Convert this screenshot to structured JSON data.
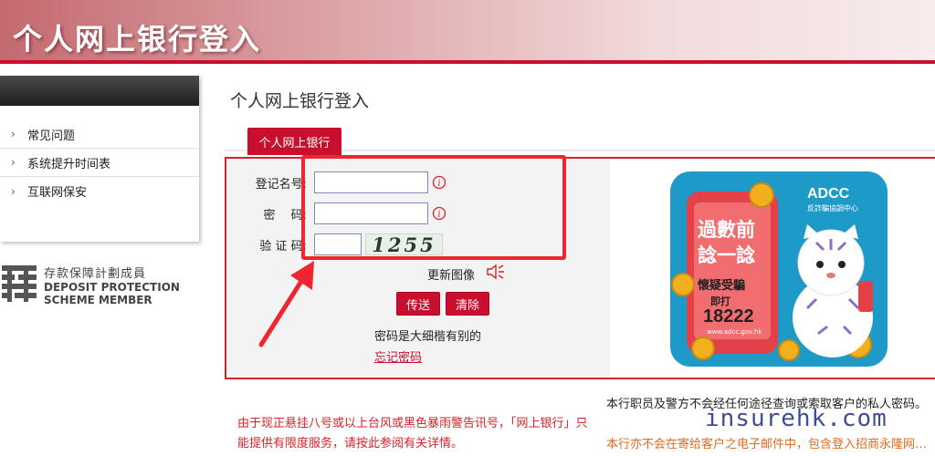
{
  "banner": {
    "title": "个人网上银行登入"
  },
  "sidebar": {
    "items": [
      {
        "label": "常见问题"
      },
      {
        "label": "系统提升时间表"
      },
      {
        "label": "互联网保安"
      }
    ]
  },
  "dps": {
    "cn": "存款保障計劃成員",
    "en_line1": "DEPOSIT PROTECTION",
    "en_line2": "SCHEME MEMBER"
  },
  "main": {
    "title": "个人网上银行登入",
    "tab_label": "个人网上银行"
  },
  "form": {
    "username_label": "登记名号:",
    "password_label": "密　 码:",
    "captcha_label": "验 证 码:",
    "username_value": "",
    "password_value": "",
    "captcha_value": "",
    "captcha_text": "1255",
    "refresh_label": "更新图像",
    "submit_label": "传送",
    "clear_label": "清除",
    "case_note": "密码是大细楷有别的",
    "forgot_label": "忘记密码"
  },
  "ad": {
    "org": "ADCC",
    "org_sub": "反詐騙協調中心",
    "line1": "過數前",
    "line2": "諗一諗",
    "line3": "懷疑受騙",
    "line4": "即打",
    "hotline": "18222",
    "site": "www.adcc.gov.hk",
    "colors": {
      "bg": "#1e9ac9",
      "phone": "#e2414a"
    }
  },
  "notices": {
    "typhoon": "由于现正悬挂八号或以上台风或黑色暴雨警告讯号，「网上银行」只能提供有限度服务，请按此参阅有关详情。",
    "staff": "本行职员及警方不会经任何途径查询或索取客户的私人密码。",
    "email": "本行亦不会在寄给客户之电子邮件中，包含登入招商永隆网…"
  },
  "watermark": "insurehk.com",
  "colors": {
    "brand_red": "#c8102e",
    "highlight": "#ef2530"
  }
}
